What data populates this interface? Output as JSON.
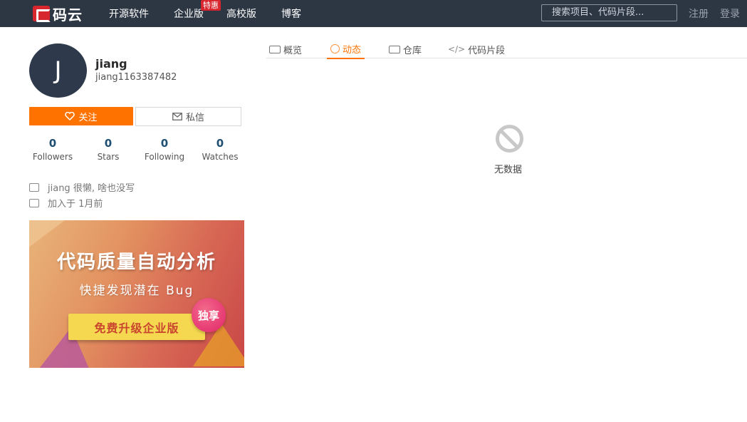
{
  "nav": {
    "logo_text": "码云",
    "items": [
      "开源软件",
      "企业版",
      "高校版",
      "博客"
    ],
    "badge": "特惠",
    "search_placeholder": "搜索项目、代码片段...",
    "register": "注册",
    "login": "登录"
  },
  "profile": {
    "avatar_letter": "J",
    "name": "jiang",
    "login": "jiang1163387482",
    "follow_label": "关注",
    "message_label": "私信",
    "stats": [
      {
        "value": "0",
        "label": "Followers"
      },
      {
        "value": "0",
        "label": "Stars"
      },
      {
        "value": "0",
        "label": "Following"
      },
      {
        "value": "0",
        "label": "Watches"
      }
    ],
    "bio": "jiang 很懒, 啥也没写",
    "joined": "加入于 1月前"
  },
  "banner": {
    "title": "代码质量自动分析",
    "subtitle": "快捷发现潜在 Bug",
    "cta": "免费升级企业版",
    "seal": "独享"
  },
  "tabs": [
    {
      "label": "概览",
      "icon": "overview-icon"
    },
    {
      "label": "动态",
      "icon": "activity-icon",
      "active": true
    },
    {
      "label": "仓库",
      "icon": "repo-icon"
    },
    {
      "label": "代码片段",
      "icon": "code-icon"
    }
  ],
  "empty": {
    "text": "无数据"
  },
  "colors": {
    "accent": "#fe7300",
    "topbar": "#2d3643",
    "brand": "#d8262f"
  }
}
